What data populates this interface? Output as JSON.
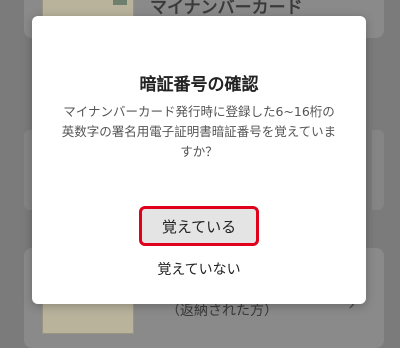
{
  "background": {
    "top_item_title": "マイナンバーカード",
    "bottom_item_label": "（返納された方）"
  },
  "dialog": {
    "title": "暗証番号の確認",
    "message": "マイナンバーカード発行時に登録した6~16桁の英数字の署名用電子証明書暗証番号を覚えていますか？",
    "primary_label": "覚えている",
    "secondary_label": "覚えていない"
  },
  "colors": {
    "highlight_border": "#e0001b"
  }
}
